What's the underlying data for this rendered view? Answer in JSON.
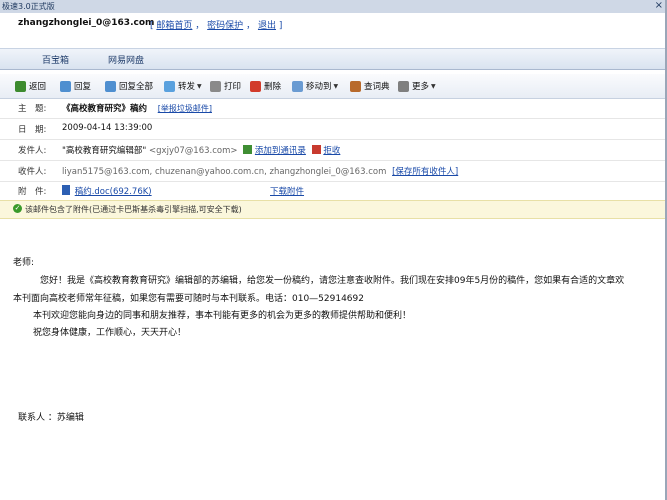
{
  "window": {
    "title": "极速3.0正式版",
    "close_glyph": "×"
  },
  "account": {
    "user": "zhangzhonglei_0@163.com",
    "bracket_open": "[",
    "bracket_close": "]",
    "sep": "，",
    "links": [
      "邮箱首页",
      "密码保护",
      "退出"
    ]
  },
  "tabs": [
    "百宝箱",
    "网易网盘"
  ],
  "toolbar": {
    "back": "返回",
    "reply": "回复",
    "reply_all": "回复全部",
    "forward": "转发",
    "print": "打印",
    "delete": "删除",
    "move_to": "移动到",
    "dictionary": "查词典",
    "more": "更多",
    "caret": "▼"
  },
  "header": {
    "subject_label": "主　题:",
    "subject": "《高校教育研究》稿约",
    "report_spam": "[举报垃圾邮件]",
    "date_label": "日　期:",
    "date": "2009-04-14 13:39:00",
    "sender_label": "发件人:",
    "sender_name": "\"高校教育研究编辑部\"",
    "sender_email": "<gxjy07@163.com>",
    "add_contact": "添加到通讯录",
    "reject": "拒收",
    "recipients_label": "收件人:",
    "recipients": "liyan5175@163.com, chuzenan@yahoo.com.cn, zhangzhonglei_0@163.com",
    "save_all": "[保存所有收件人]",
    "attachment_label": "附　件:",
    "attachment_name": "稿约.doc(692.76K)",
    "download": "下载附件"
  },
  "notice": "该邮件包含了附件(已通过卡巴斯基杀毒引擎扫描,可安全下载)",
  "notice_icon": "✓",
  "body": {
    "greeting": "老师:",
    "line1": "您好！我是《高校教育教育研究》编辑部的苏编辑，给您发一份稿约，请您注意查收附件。我们现在安排09年5月份的稿件，您如果有合适的文章欢",
    "line2": "本刊面向高校老师常年征稿，如果您有需要可随时与本刊联系。电话：010—52914692",
    "line3": "本刊欢迎您能向身边的同事和朋友推荐，事本刊能有更多的机会为更多的教师提供帮助和便利！",
    "line4": "祝您身体健康，工作顺心，天天开心！",
    "contact": "联系人 ：苏编辑"
  },
  "colors": {
    "link": "#1a4aa8",
    "toolbar_bg": "#e8edf5",
    "notice_bg": "#fbf7dc"
  }
}
